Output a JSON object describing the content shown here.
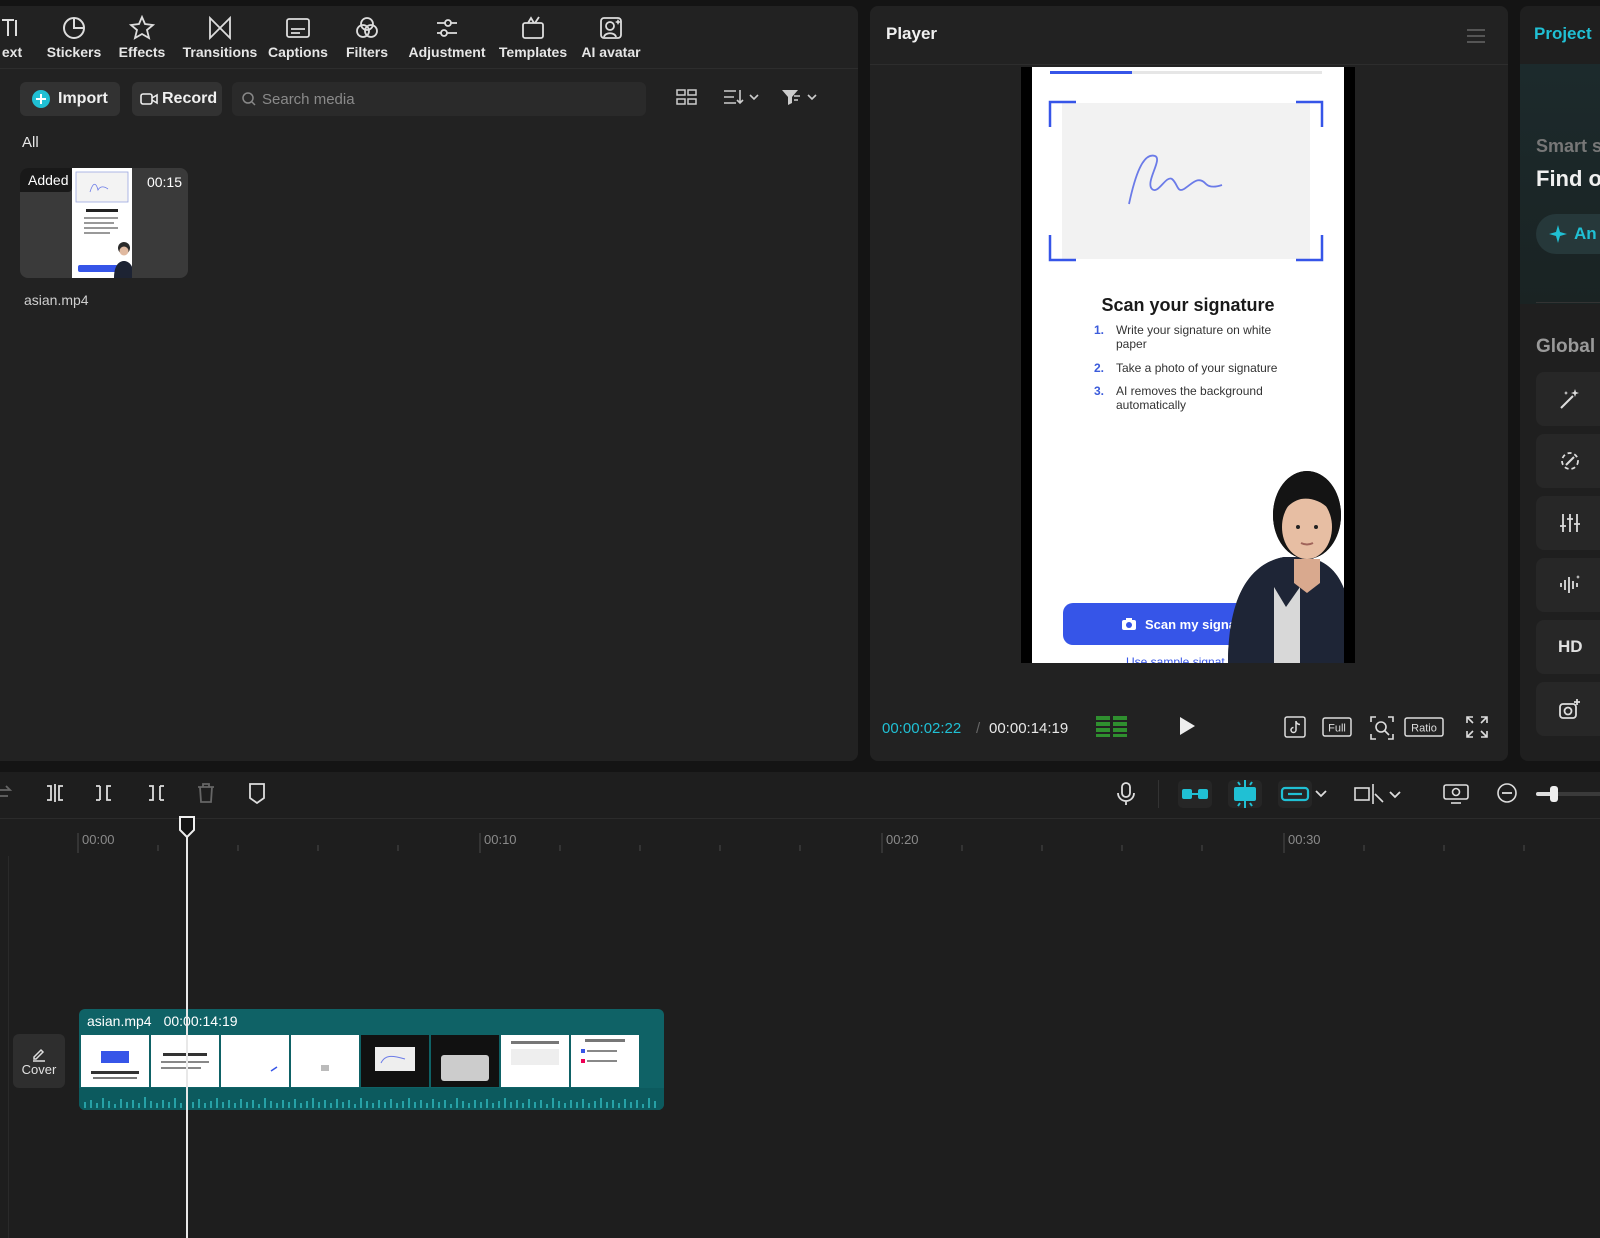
{
  "toolbar": {
    "tabs": [
      {
        "label": "ext",
        "icon": "text-icon"
      },
      {
        "label": "Stickers",
        "icon": "stickers-icon"
      },
      {
        "label": "Effects",
        "icon": "effects-icon"
      },
      {
        "label": "Transitions",
        "icon": "transitions-icon"
      },
      {
        "label": "Captions",
        "icon": "captions-icon"
      },
      {
        "label": "Filters",
        "icon": "filters-icon"
      },
      {
        "label": "Adjustment",
        "icon": "adjustment-icon"
      },
      {
        "label": "Templates",
        "icon": "templates-icon"
      },
      {
        "label": "AI avatar",
        "icon": "ai-avatar-icon"
      }
    ]
  },
  "media": {
    "import_label": "Import",
    "record_label": "Record",
    "search_placeholder": "Search media",
    "filter_all": "All",
    "item": {
      "badge": "Added",
      "duration": "00:15",
      "filename": "asian.mp4"
    }
  },
  "player": {
    "title": "Player",
    "current_time": "00:00:02:22",
    "separator": "/",
    "total_time": "00:00:14:19",
    "controls": {
      "full": "Full",
      "ratio": "Ratio"
    },
    "preview": {
      "title": "Scan your signature",
      "steps": [
        {
          "n": "1.",
          "text": "Write your signature on white paper"
        },
        {
          "n": "2.",
          "text": "Take a photo of your signature"
        },
        {
          "n": "3.",
          "text": "AI removes the background automatically"
        }
      ],
      "button": "Scan my signa",
      "link": "Use sample signat"
    }
  },
  "properties": {
    "tab": "Project",
    "smart_label": "Smart s",
    "heading": "Find o",
    "ai_button": "An",
    "global_label": "Global",
    "items": [
      {
        "icon": "magic-wand-icon"
      },
      {
        "icon": "enhance-icon"
      },
      {
        "icon": "sliders-icon"
      },
      {
        "icon": "audio-wave-icon"
      },
      {
        "icon": "hd-icon",
        "label": "HD"
      },
      {
        "icon": "camera-plus-icon"
      }
    ]
  },
  "timeline": {
    "ruler": [
      "00:00",
      "00:10",
      "00:20",
      "00:30"
    ],
    "clip": {
      "name": "asian.mp4",
      "duration": "00:00:14:19"
    },
    "cover_label": "Cover"
  },
  "colors": {
    "accent": "#20c0d4",
    "clip": "#0f6266",
    "preview_button": "#3655e8"
  }
}
